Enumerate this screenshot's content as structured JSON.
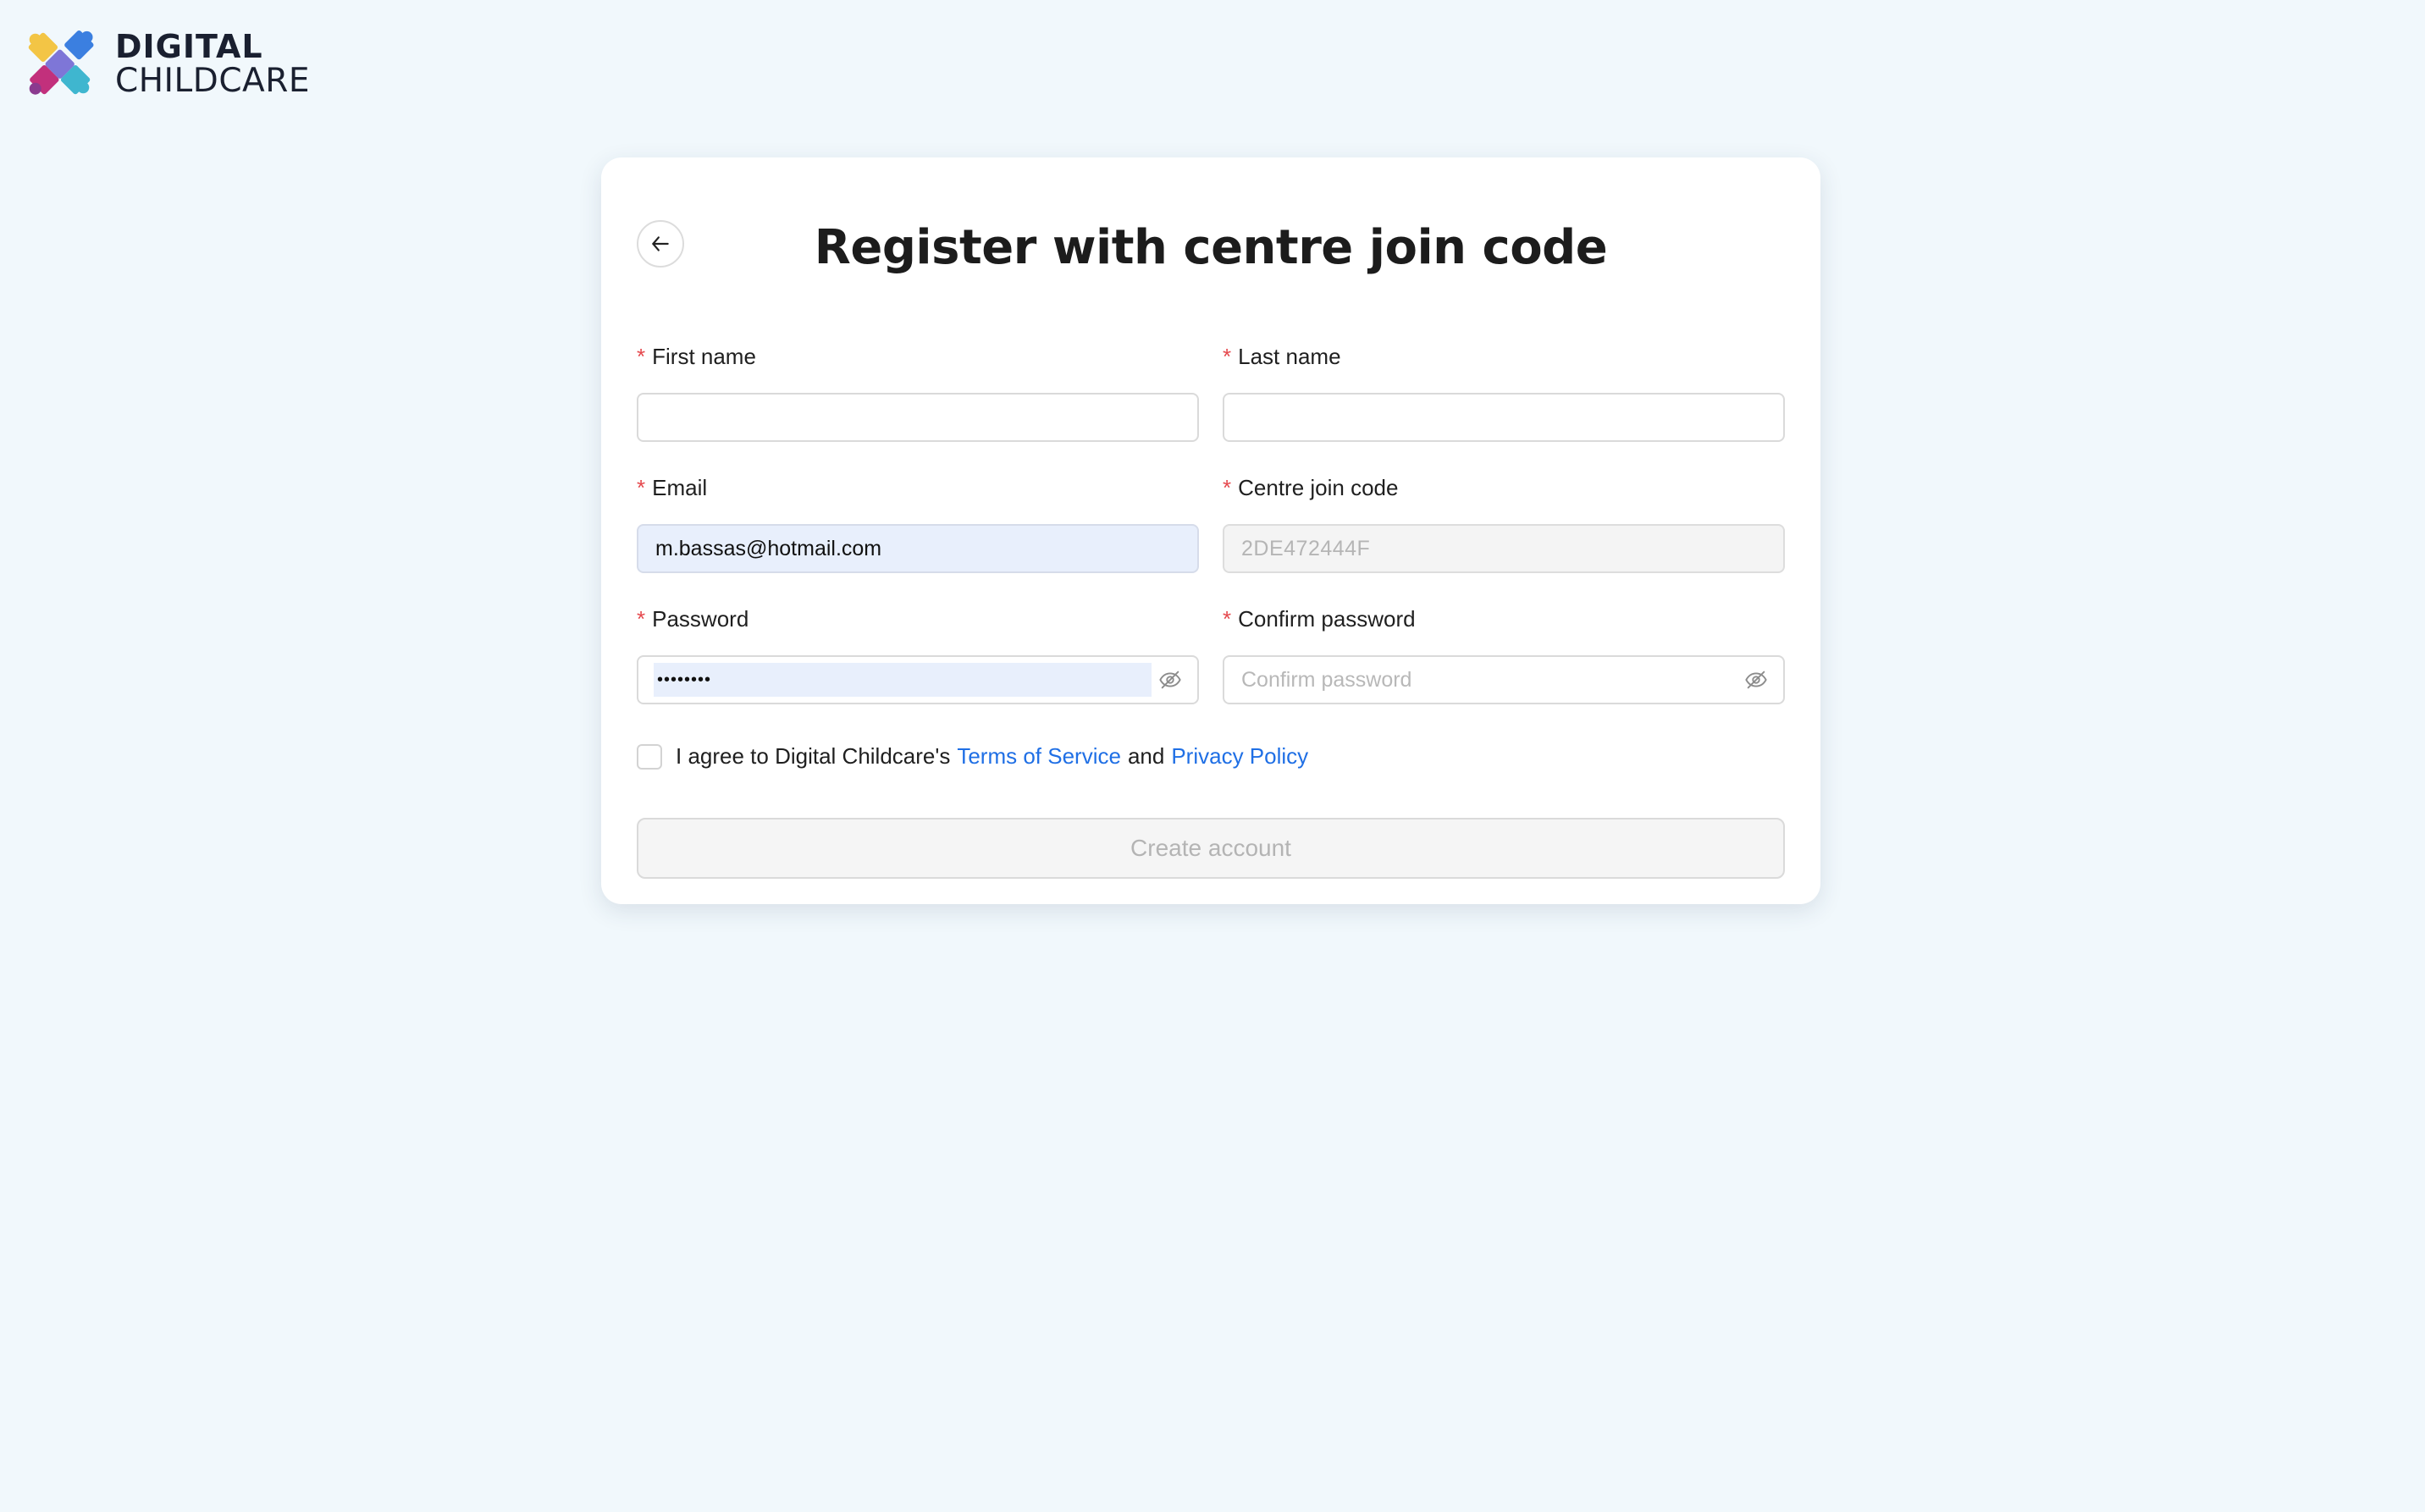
{
  "brand": {
    "line1": "DIGITAL",
    "line2": "CHILDCARE",
    "colors": {
      "yellow": "#f3c545",
      "blue": "#3b7fe0",
      "teal": "#3fb6cf",
      "magenta": "#c2307c",
      "purple": "#8b3a8f"
    }
  },
  "form": {
    "back_icon": "arrow-left-icon",
    "title": "Register with centre join code",
    "required_marker": "*",
    "first_name": {
      "label": "First name",
      "value": ""
    },
    "last_name": {
      "label": "Last name",
      "value": ""
    },
    "email": {
      "label": "Email",
      "value": "m.bassas@hotmail.com"
    },
    "join_code": {
      "label": "Centre join code",
      "value": "2DE472444F"
    },
    "password": {
      "label": "Password",
      "value": "••••••••",
      "toggle_icon": "eye-off-icon"
    },
    "confirm_password": {
      "label": "Confirm password",
      "placeholder": "Confirm password",
      "toggle_icon": "eye-off-icon"
    },
    "agree": {
      "prefix": "I agree to Digital Childcare's",
      "terms": "Terms of Service",
      "and": "and",
      "privacy": "Privacy Policy",
      "checked": false
    },
    "submit_label": "Create account"
  },
  "colors": {
    "background": "#f1f8fc",
    "link": "#1f6fe5",
    "required": "#e5484d",
    "autofill": "#e8effc"
  }
}
